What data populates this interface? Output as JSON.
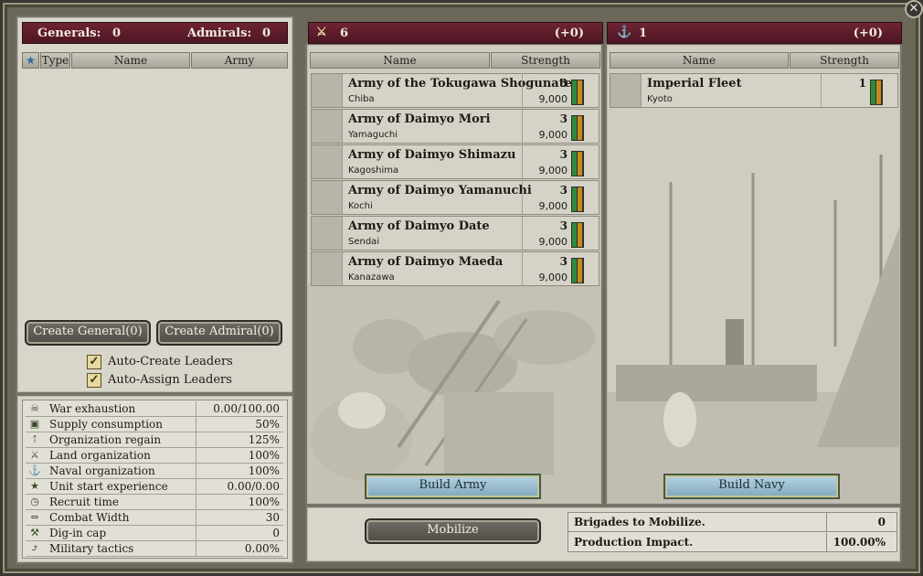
{
  "leaders": {
    "generals_label": "Generals:",
    "generals_count": "0",
    "admirals_label": "Admirals:",
    "admirals_count": "0",
    "col_type": "Type",
    "col_name": "Name",
    "col_army": "Army",
    "create_general": "Create General(0)",
    "create_admiral": "Create Admiral(0)",
    "auto_create": "Auto-Create Leaders",
    "auto_assign": "Auto-Assign Leaders"
  },
  "stats": [
    {
      "icon": "war-exhaustion-icon",
      "glyph": "☠",
      "label": "War exhaustion",
      "value": "0.00/100.00"
    },
    {
      "icon": "supply-icon",
      "glyph": "▣",
      "label": "Supply consumption",
      "value": "50%"
    },
    {
      "icon": "organization-regain-icon",
      "glyph": "⇡",
      "label": "Organization regain",
      "value": "125%"
    },
    {
      "icon": "land-organization-icon",
      "glyph": "⚔",
      "label": "Land organization",
      "value": "100%"
    },
    {
      "icon": "naval-organization-icon",
      "glyph": "⚓",
      "label": "Naval organization",
      "value": "100%"
    },
    {
      "icon": "experience-star-icon",
      "glyph": "★",
      "label": "Unit start experience",
      "value": "0.00/0.00"
    },
    {
      "icon": "clock-icon",
      "glyph": "◷",
      "label": "Recruit time",
      "value": "100%"
    },
    {
      "icon": "combat-width-icon",
      "glyph": "⇔",
      "label": "Combat Width",
      "value": "30"
    },
    {
      "icon": "shovel-icon",
      "glyph": "⚒",
      "label": "Dig-in cap",
      "value": "0"
    },
    {
      "icon": "tactics-icon",
      "glyph": "⤴",
      "label": "Military tactics",
      "value": "0.00%"
    }
  ],
  "armies": {
    "count": "6",
    "change": "(+0)",
    "col_name": "Name",
    "col_strength": "Strength",
    "build_label": "Build Army",
    "items": [
      {
        "name": "Army of the Tokugawa Shogunate",
        "location": "Chiba",
        "count": "3",
        "strength": "9,000"
      },
      {
        "name": "Army of Daimyo Mori",
        "location": "Yamaguchi",
        "count": "3",
        "strength": "9,000"
      },
      {
        "name": "Army of Daimyo Shimazu",
        "location": "Kagoshima",
        "count": "3",
        "strength": "9,000"
      },
      {
        "name": "Army of Daimyo Yamanuchi",
        "location": "Kochi",
        "count": "3",
        "strength": "9,000"
      },
      {
        "name": "Army of Daimyo Date",
        "location": "Sendai",
        "count": "3",
        "strength": "9,000"
      },
      {
        "name": "Army of Daimyo Maeda",
        "location": "Kanazawa",
        "count": "3",
        "strength": "9,000"
      }
    ]
  },
  "navies": {
    "count": "1",
    "change": "(+0)",
    "col_name": "Name",
    "col_strength": "Strength",
    "build_label": "Build Navy",
    "items": [
      {
        "name": "Imperial Fleet",
        "location": "Kyoto",
        "count": "1"
      }
    ]
  },
  "mobilize": {
    "button": "Mobilize",
    "brigades_label": "Brigades to Mobilize.",
    "brigades_value": "0",
    "impact_label": "Production Impact.",
    "impact_value": "100.00%"
  }
}
